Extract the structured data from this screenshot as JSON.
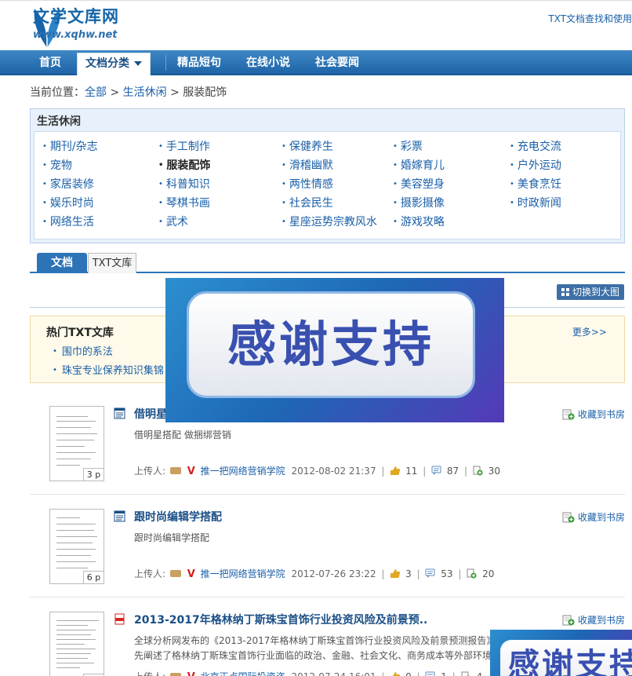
{
  "header": {
    "logo_text": "文学文库网",
    "logo_url": "www.xqhw.net",
    "top_link": "TXT文档查找和使用"
  },
  "nav": {
    "items": [
      {
        "label": "首页"
      },
      {
        "label": "文档分类",
        "active": true
      },
      {
        "label": "精品短句"
      },
      {
        "label": "在线小说"
      },
      {
        "label": "社会要闻"
      }
    ]
  },
  "breadcrumb": {
    "prefix": "当前位置：",
    "links": [
      "全部",
      "生活休闲"
    ],
    "separator": ">",
    "current": "服装配饰"
  },
  "categories": {
    "title": "生活休闲",
    "items": [
      "期刊/杂志",
      "手工制作",
      "保健养生",
      "彩票",
      "充电交流",
      "宠物",
      "服装配饰",
      "滑稽幽默",
      "婚嫁育儿",
      "户外运动",
      "家居装修",
      "科普知识",
      "两性情感",
      "美容塑身",
      "美食烹饪",
      "娱乐时尚",
      "琴棋书画",
      "社会民生",
      "摄影摄像",
      "时政新闻",
      "网络生活",
      "武术",
      "星座运势宗教风水",
      "游戏攻略"
    ],
    "selected": "服装配饰"
  },
  "tabs": [
    "文档",
    "TXT文库"
  ],
  "switch_button": "切换到大图",
  "hot": {
    "title": "热门TXT文库",
    "more": "更多>>",
    "items": [
      "围巾的系法",
      "珠宝专业保养知识集锦"
    ]
  },
  "docs": [
    {
      "title": "借明星",
      "desc": "借明星搭配 做捆绑营销",
      "desc2": "",
      "pages": "3 p",
      "uploader_label": "上传人:",
      "author": "推一把网络营销学院",
      "time": "2012-08-02 21:37",
      "likes": "11",
      "comments": "87",
      "adds": "30",
      "collect": "收藏到书房",
      "filetype": "word"
    },
    {
      "title": "跟时尚编辑学搭配",
      "desc": "跟时尚编辑学搭配",
      "desc2": "",
      "pages": "6 p",
      "uploader_label": "上传人:",
      "author": "推一把网络营销学院",
      "time": "2012-07-26 23:22",
      "likes": "3",
      "comments": "53",
      "adds": "20",
      "collect": "收藏到书房",
      "filetype": "word"
    },
    {
      "title": "2013-2017年格林纳丁斯珠宝首饰行业投资风险及前景预..",
      "desc": "全球分析网发布的《2013-2017年格林纳丁斯珠宝首饰行业投资风险及前景预测报告》",
      "desc2": "先阐述了格林纳丁斯珠宝首饰行业面临的政治、金融、社会文化、商务成本等外部环境",
      "pages": "",
      "uploader_label": "上传人:",
      "author": "北京正点国际投资咨",
      "time": "2012-07-24 16:01",
      "likes": "0",
      "comments": "1",
      "adds": "4",
      "collect": "收藏到书房",
      "filetype": "pdf"
    }
  ],
  "banner": {
    "text": "感谢支持"
  },
  "colors": {
    "nav_blue": "#1e64a6",
    "link_blue": "#1a5fa8",
    "hot_bg": "#fffaea",
    "cat_bg": "#e8f1fb"
  }
}
